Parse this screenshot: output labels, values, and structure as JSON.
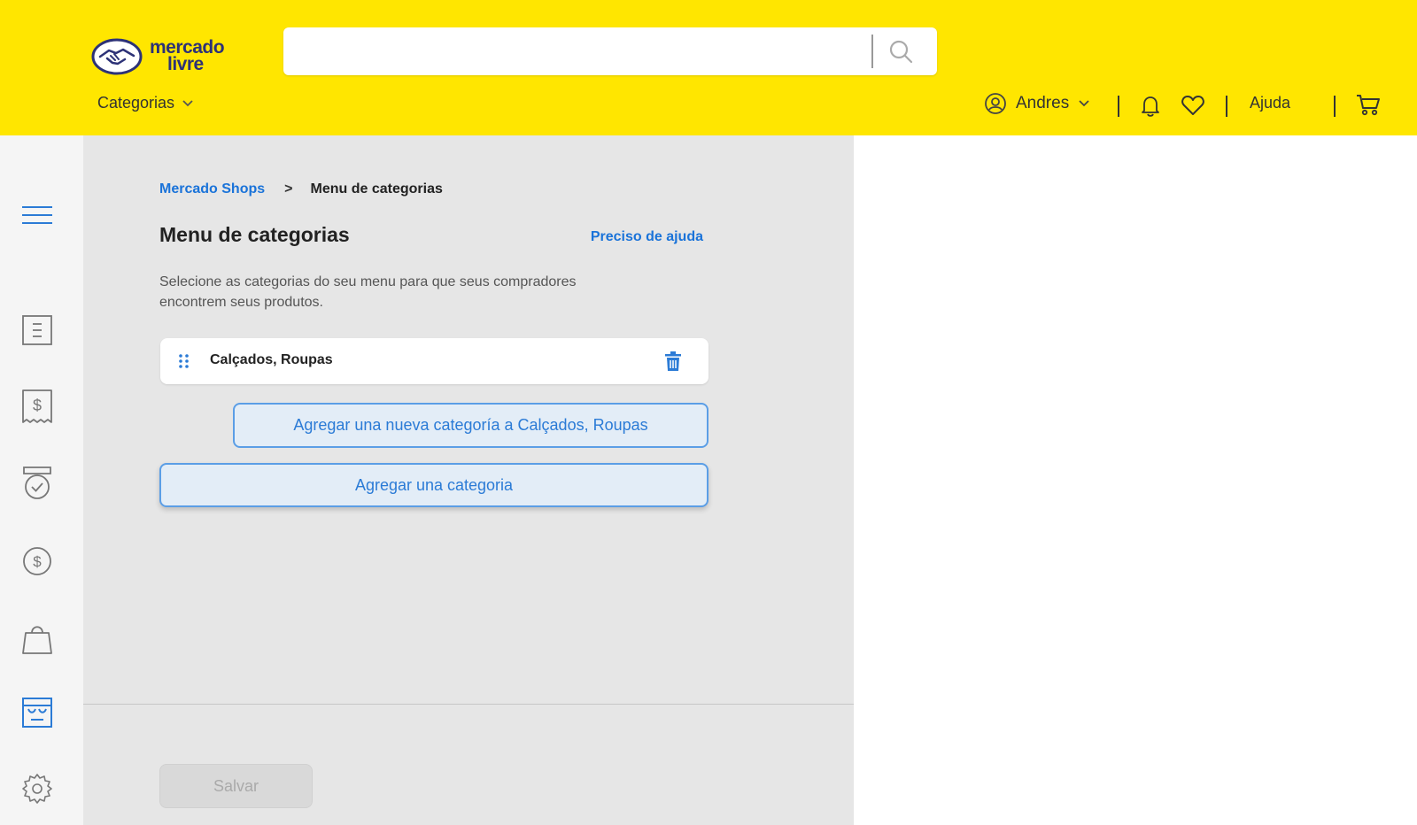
{
  "header": {
    "logo_text_line1": "mercado",
    "logo_text_line2": "livre",
    "search": {
      "value": "",
      "placeholder": ""
    },
    "categorias_label": "Categorias",
    "user_name": "Andres",
    "ajuda_label": "Ajuda"
  },
  "sidebar": {
    "items": [
      {
        "icon": "menu-icon"
      },
      {
        "icon": "list-icon"
      },
      {
        "icon": "receipt-dollar-icon"
      },
      {
        "icon": "badge-check-icon"
      },
      {
        "icon": "dollar-circle-icon"
      },
      {
        "icon": "shopping-bag-icon"
      },
      {
        "icon": "store-icon",
        "active": true
      },
      {
        "icon": "gear-icon"
      }
    ]
  },
  "main": {
    "breadcrumb": {
      "parent": "Mercado Shops",
      "separator": ">",
      "current": "Menu de categorias"
    },
    "title": "Menu de categorias",
    "help_link": "Preciso de ajuda",
    "description": "Selecione as categorias do seu menu para que seus compradores encontrem seus produtos.",
    "category_item": {
      "name": "Calçados, Roupas"
    },
    "add_subcategory_button": "Agregar una nueva categoría a Calçados, Roupas",
    "add_category_button": "Agregar una categoria",
    "save_button": "Salvar"
  },
  "colors": {
    "header_bg": "#ffe600",
    "accent_blue": "#1a73d9",
    "panel_bg": "#e6e6e6"
  }
}
